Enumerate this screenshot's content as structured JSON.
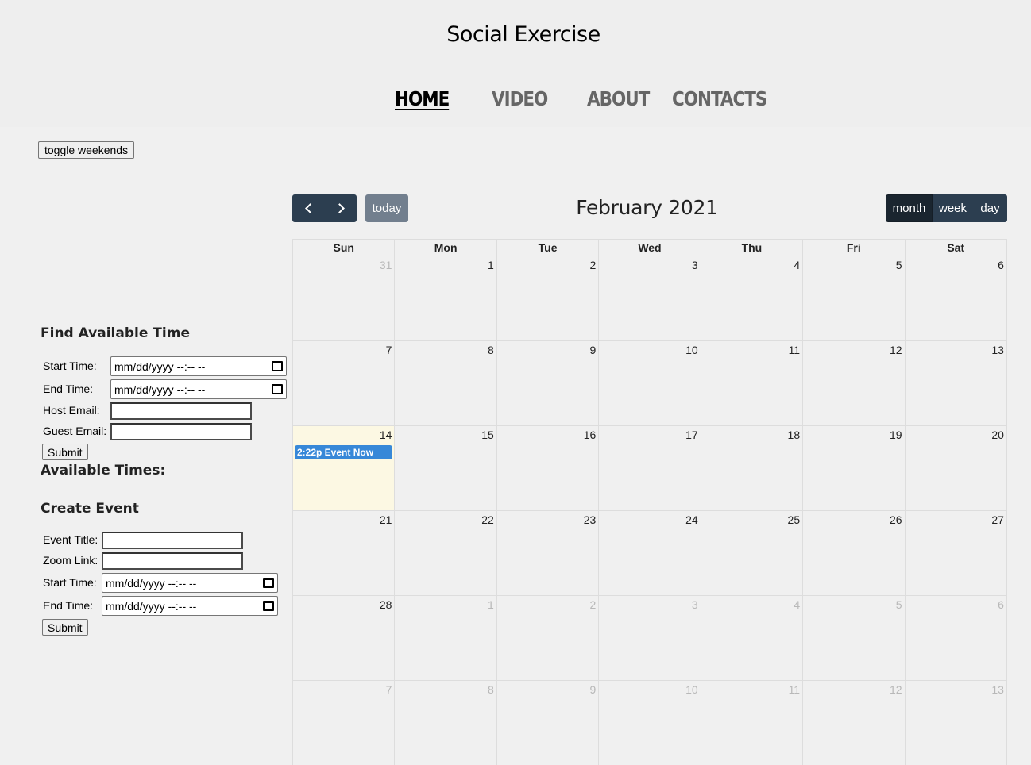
{
  "header": {
    "title": "Social Exercise",
    "nav": [
      {
        "label": "Home",
        "active": true
      },
      {
        "label": "Video",
        "active": false
      },
      {
        "label": "About",
        "active": false
      },
      {
        "label": "Contacts",
        "active": false
      }
    ]
  },
  "toggle_weekends_label": "toggle weekends",
  "find_time": {
    "title": "Find Available Time",
    "start_label": "Start Time:",
    "end_label": "End Time:",
    "host_email_label": "Host Email:",
    "guest_email_label": "Guest Email:",
    "datetime_placeholder": "mm/dd/yyyy --:-- --",
    "submit_label": "Submit",
    "available_times_title": "Available Times:"
  },
  "create_event": {
    "title": "Create Event",
    "event_title_label": "Event Title:",
    "zoom_link_label": "Zoom Link:",
    "start_label": "Start Time:",
    "end_label": "End Time:",
    "datetime_placeholder": "mm/dd/yyyy --:-- --",
    "submit_label": "Submit"
  },
  "calendar": {
    "title": "February 2021",
    "today_label": "today",
    "views": [
      {
        "label": "month",
        "active": true
      },
      {
        "label": "week",
        "active": false
      },
      {
        "label": "day",
        "active": false
      }
    ],
    "weekdays": [
      "Sun",
      "Mon",
      "Tue",
      "Wed",
      "Thu",
      "Fri",
      "Sat"
    ],
    "weeks": [
      [
        {
          "d": "31",
          "other": true
        },
        {
          "d": "1"
        },
        {
          "d": "2"
        },
        {
          "d": "3"
        },
        {
          "d": "4"
        },
        {
          "d": "5"
        },
        {
          "d": "6"
        }
      ],
      [
        {
          "d": "7"
        },
        {
          "d": "8"
        },
        {
          "d": "9"
        },
        {
          "d": "10"
        },
        {
          "d": "11"
        },
        {
          "d": "12"
        },
        {
          "d": "13"
        }
      ],
      [
        {
          "d": "14",
          "today": true,
          "event": "2:22p Event Now"
        },
        {
          "d": "15"
        },
        {
          "d": "16"
        },
        {
          "d": "17"
        },
        {
          "d": "18"
        },
        {
          "d": "19"
        },
        {
          "d": "20"
        }
      ],
      [
        {
          "d": "21"
        },
        {
          "d": "22"
        },
        {
          "d": "23"
        },
        {
          "d": "24"
        },
        {
          "d": "25"
        },
        {
          "d": "26"
        },
        {
          "d": "27"
        }
      ],
      [
        {
          "d": "28"
        },
        {
          "d": "1",
          "other": true
        },
        {
          "d": "2",
          "other": true
        },
        {
          "d": "3",
          "other": true
        },
        {
          "d": "4",
          "other": true
        },
        {
          "d": "5",
          "other": true
        },
        {
          "d": "6",
          "other": true
        }
      ],
      [
        {
          "d": "7",
          "other": true
        },
        {
          "d": "8",
          "other": true
        },
        {
          "d": "9",
          "other": true
        },
        {
          "d": "10",
          "other": true
        },
        {
          "d": "11",
          "other": true
        },
        {
          "d": "12",
          "other": true
        },
        {
          "d": "13",
          "other": true
        }
      ]
    ],
    "colors": {
      "toolbar": "#2c3e50",
      "today_bg": "#fcf8e3",
      "event": "#3788d8"
    }
  }
}
